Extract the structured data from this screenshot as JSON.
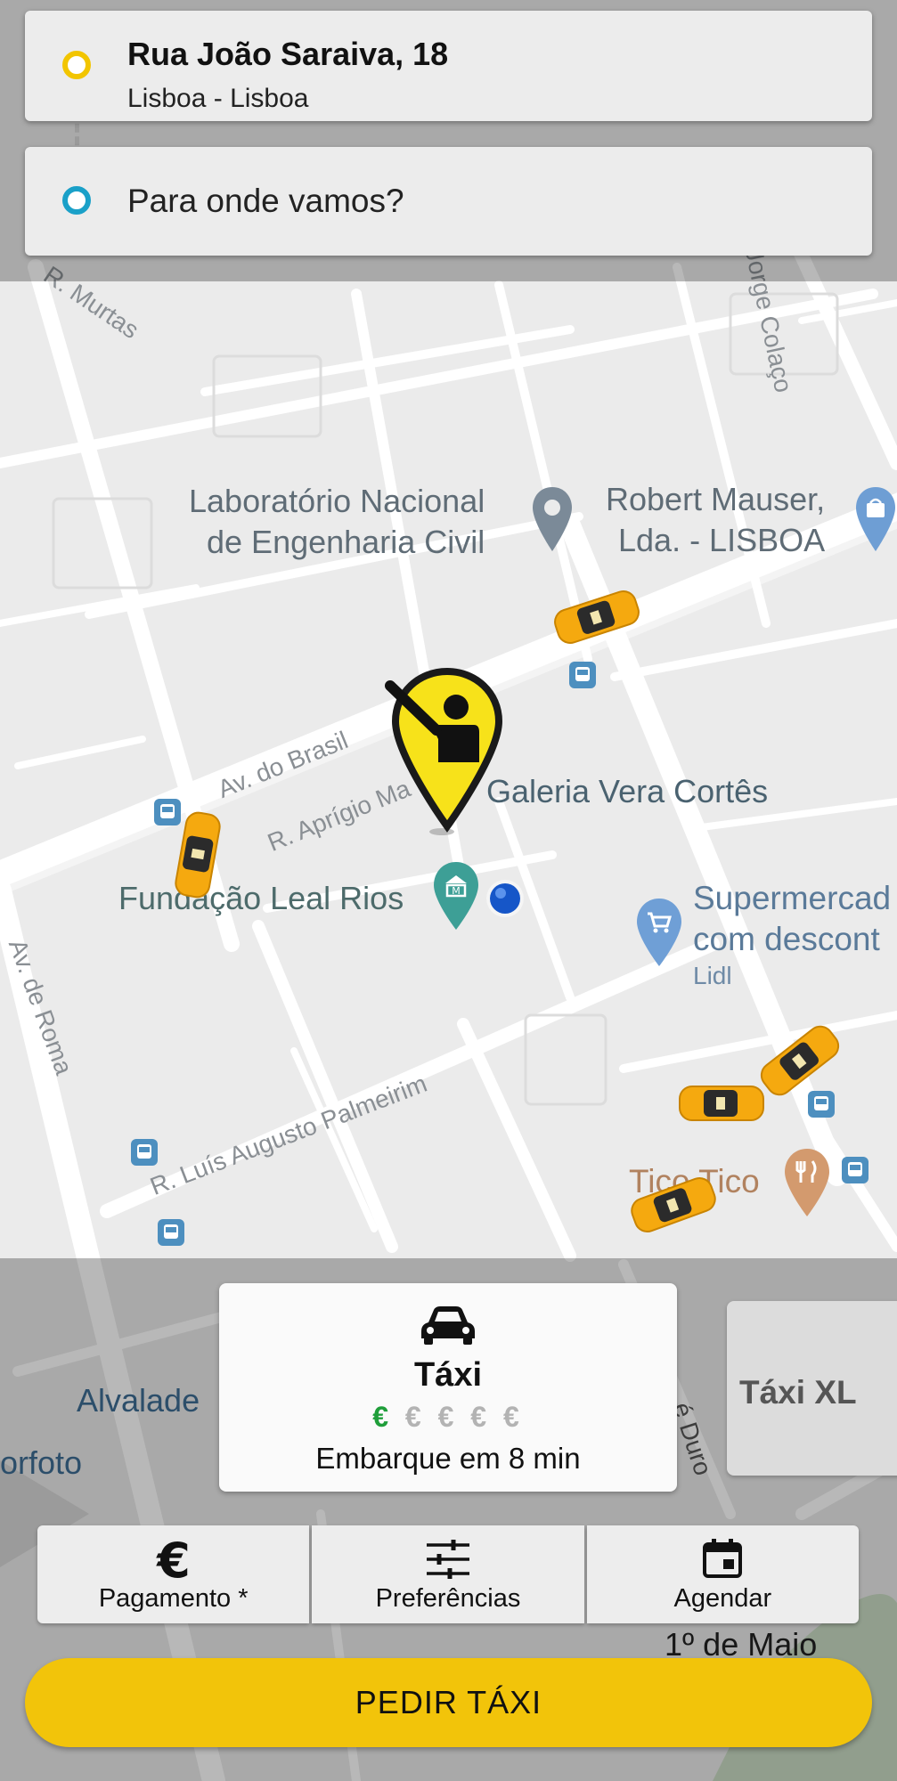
{
  "origin": {
    "street": "Rua João Saraiva, 18",
    "city": "Lisboa - Lisboa"
  },
  "destination": {
    "placeholder": "Para onde vamos?"
  },
  "map": {
    "pois": {
      "lnec_line1": "Laboratório Nacional",
      "lnec_line2": "de Engenharia Civil",
      "mauser_line1": "Robert Mauser,",
      "mauser_line2": "Lda. - LISBOA",
      "galeria": "Galeria Vera Cortês",
      "fundacao": "Fundação Leal Rios",
      "supermercado_line1": "Supermercad",
      "supermercado_line2": "com descont",
      "supermercado_line3": "Lidl",
      "tico": "Tico Tico",
      "alvalade": "Alvalade",
      "orfoto": "orfoto",
      "primeiro_maio": "1º de Maio"
    },
    "streets": {
      "murtas": "R. Murtas",
      "jorge_colaco": "R. Jorge Colaço",
      "av_brasil": "Av. do Brasil",
      "aprigio": "R. Aprígio Ma",
      "av_roma": "Av. de Roma",
      "palmeirim": "R. Luís Augusto Palmeirim",
      "duro": "é Duro"
    }
  },
  "service": {
    "selected": {
      "name": "Táxi",
      "price_active": "€",
      "price_inactive": "€ € € €",
      "eta": "Embarque em 8 min"
    },
    "next": {
      "name": "Táxi XL"
    }
  },
  "options": {
    "payment": "Pagamento *",
    "preferences": "Preferências",
    "schedule": "Agendar"
  },
  "request_button": "PEDIR TÁXI",
  "colors": {
    "accent_yellow": "#f2c40a",
    "price_green": "#1f9e3a",
    "destination_blue": "#1aa0c8"
  }
}
